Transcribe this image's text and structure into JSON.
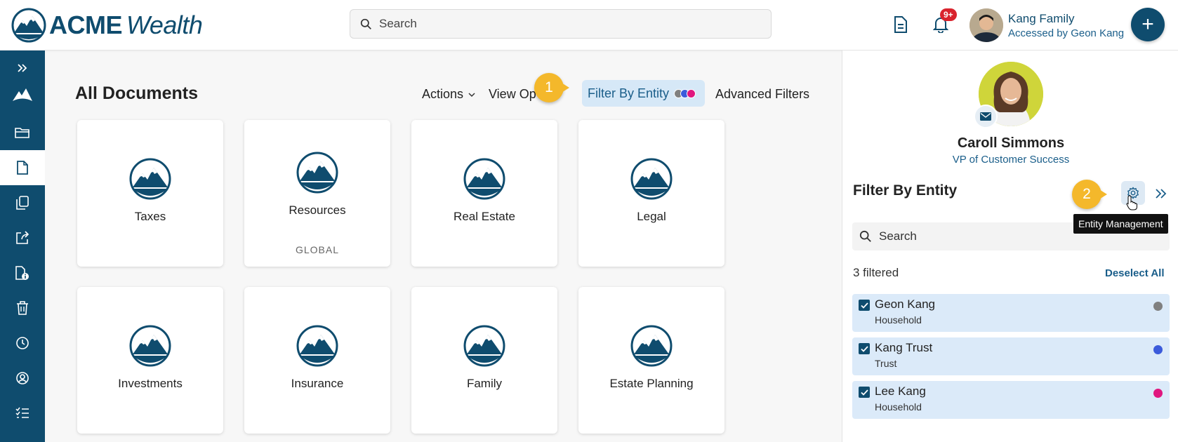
{
  "header": {
    "logo_bold": "ACME",
    "logo_italic": "Wealth",
    "search_placeholder": "Search",
    "notification_badge": "9+",
    "user_name": "Kang Family",
    "user_sub": "Accessed by Geon Kang",
    "fab_label": "+"
  },
  "sidebar": {
    "items": [
      "expand-icon",
      "home-mountain-icon",
      "folder-open-icon",
      "document-icon",
      "copy-icon",
      "share-icon",
      "document-info-icon",
      "trash-icon",
      "clock-icon",
      "user-circle-icon",
      "checklist-icon"
    ],
    "active_index": 3
  },
  "main": {
    "title": "All Documents",
    "toolbar": {
      "actions": "Actions",
      "view_options": "View Op",
      "filter_by_entity": "Filter By Entity",
      "advanced_filters": "Advanced Filters"
    },
    "callout_1": "1",
    "cards": [
      {
        "label": "Taxes",
        "sub": ""
      },
      {
        "label": "Resources",
        "sub": "GLOBAL"
      },
      {
        "label": "Real Estate",
        "sub": ""
      },
      {
        "label": "Legal",
        "sub": ""
      },
      {
        "label": "Investments",
        "sub": ""
      },
      {
        "label": "Insurance",
        "sub": ""
      },
      {
        "label": "Family",
        "sub": ""
      },
      {
        "label": "Estate Planning",
        "sub": ""
      }
    ]
  },
  "right_panel": {
    "contact_name": "Caroll Simmons",
    "contact_title": "VP of Customer Success",
    "title": "Filter By Entity",
    "callout_2": "2",
    "tooltip": "Entity Management",
    "search_placeholder": "Search",
    "filtered_count": "3 filtered",
    "deselect_all": "Deselect All",
    "entities": [
      {
        "name": "Geon Kang",
        "type": "Household",
        "color": "#808080"
      },
      {
        "name": "Kang Trust",
        "type": "Trust",
        "color": "#3b5bdb"
      },
      {
        "name": "Lee Kang",
        "type": "Household",
        "color": "#e0177f"
      }
    ]
  },
  "colors": {
    "brand": "#0f4c6e",
    "accent_link": "#1a5e8a",
    "callout": "#f4b82b",
    "pill_bg": "#d6e8f7"
  }
}
